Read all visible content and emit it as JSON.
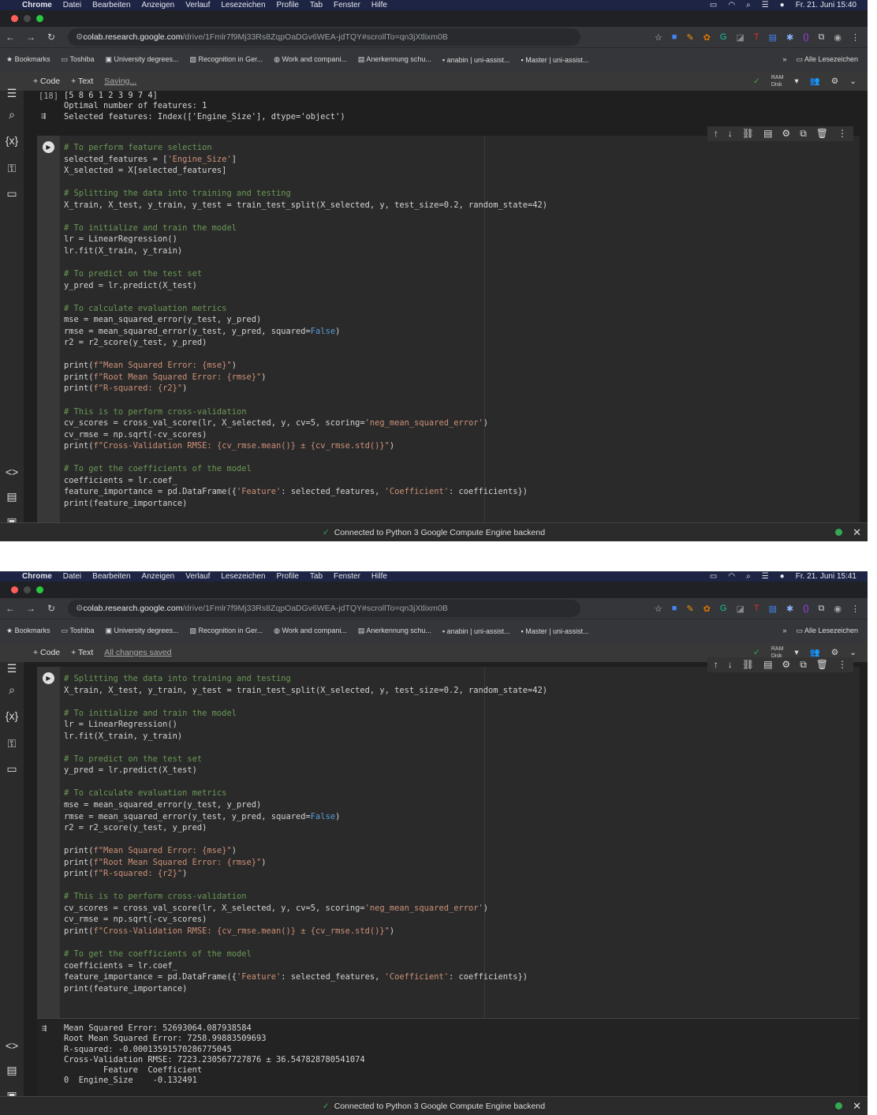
{
  "colors": {
    "menubar": "#1d2444",
    "accent_green": "#34a853",
    "comment": "#6a9955",
    "string": "#ce9178",
    "keyword": "#569cd6"
  },
  "menubar": {
    "apple": "",
    "items": [
      "Chrome",
      "Datei",
      "Bearbeiten",
      "Anzeigen",
      "Verlauf",
      "Lesezeichen",
      "Profile",
      "Tab",
      "Fenster",
      "Hilfe"
    ]
  },
  "browser": {
    "url_host": "colab.research.google.com",
    "url_path": "/drive/1Fmlr7f9Mj33Rs8ZqpOaDGv6WEA-jdTQY#scrollTo=qn3jXtlixm0B",
    "bookmarks": [
      "Bookmarks",
      "Toshiba",
      "University degrees...",
      "Recognition in Ger...",
      "Work and compani...",
      "Anerkennung schu...",
      "anabin | uni-assist...",
      "Master | uni-assist..."
    ],
    "more": "»",
    "all_bookmarks": "Alle Lesezeichen"
  },
  "colab": {
    "add_code": "+ Code",
    "add_text": "+ Text",
    "ram": "RAM",
    "disk": "Disk",
    "connected": "Connected to Python 3 Google Compute Engine backend"
  },
  "panels": [
    {
      "clock": "Fr. 21. Juni 15:40",
      "save_status": "Saving...",
      "prev_output": {
        "exec_count": "[18]",
        "lines": [
          "[5 8 6 1 2 3 9 7 4]",
          "Optimal number of features: 1",
          "Selected features: Index(['Engine_Size'], dtype='object')"
        ]
      },
      "code": [
        "# To perform feature selection",
        "selected_features = ['Engine_Size']",
        "X_selected = X[selected_features]",
        "",
        "# Splitting the data into training and testing",
        "X_train, X_test, y_train, y_test = train_test_split(X_selected, y, test_size=0.2, random_state=42)",
        "",
        "# To initialize and train the model",
        "lr = LinearRegression()",
        "lr.fit(X_train, y_train)",
        "",
        "# To predict on the test set",
        "y_pred = lr.predict(X_test)",
        "",
        "# To calculate evaluation metrics",
        "mse = mean_squared_error(y_test, y_pred)",
        "rmse = mean_squared_error(y_test, y_pred, squared=False)",
        "r2 = r2_score(y_test, y_pred)",
        "",
        "print(f\"Mean Squared Error: {mse}\")",
        "print(f\"Root Mean Squared Error: {rmse}\")",
        "print(f\"R-squared: {r2}\")",
        "",
        "# This is to perform cross-validation",
        "cv_scores = cross_val_score(lr, X_selected, y, cv=5, scoring='neg_mean_squared_error')",
        "cv_rmse = np.sqrt(-cv_scores)",
        "print(f\"Cross-Validation RMSE: {cv_rmse.mean()} ± {cv_rmse.std()}\")",
        "",
        "# To get the coefficients of the model",
        "coefficients = lr.coef_",
        "feature_importance = pd.DataFrame({'Feature': selected_features, 'Coefficient': coefficients})",
        "print(feature_importance)"
      ],
      "output": []
    },
    {
      "clock": "Fr. 21. Juni 15:41",
      "save_status": "All changes saved",
      "code": [
        "# Splitting the data into training and testing",
        "X_train, X_test, y_train, y_test = train_test_split(X_selected, y, test_size=0.2, random_state=42)",
        "",
        "# To initialize and train the model",
        "lr = LinearRegression()",
        "lr.fit(X_train, y_train)",
        "",
        "# To predict on the test set",
        "y_pred = lr.predict(X_test)",
        "",
        "# To calculate evaluation metrics",
        "mse = mean_squared_error(y_test, y_pred)",
        "rmse = mean_squared_error(y_test, y_pred, squared=False)",
        "r2 = r2_score(y_test, y_pred)",
        "",
        "print(f\"Mean Squared Error: {mse}\")",
        "print(f\"Root Mean Squared Error: {rmse}\")",
        "print(f\"R-squared: {r2}\")",
        "",
        "# This is to perform cross-validation",
        "cv_scores = cross_val_score(lr, X_selected, y, cv=5, scoring='neg_mean_squared_error')",
        "cv_rmse = np.sqrt(-cv_scores)",
        "print(f\"Cross-Validation RMSE: {cv_rmse.mean()} ± {cv_rmse.std()}\")",
        "",
        "# To get the coefficients of the model",
        "coefficients = lr.coef_",
        "feature_importance = pd.DataFrame({'Feature': selected_features, 'Coefficient': coefficients})",
        "print(feature_importance)"
      ],
      "output": [
        "Mean Squared Error: 52693064.087938584",
        "Root Mean Squared Error: 7258.99883509693",
        "R-squared: -0.00013591570286775045",
        "Cross-Validation RMSE: 7223.230567727876 ± 36.547828780541074",
        "        Feature  Coefficient",
        "0  Engine_Size    -0.132491"
      ]
    }
  ]
}
